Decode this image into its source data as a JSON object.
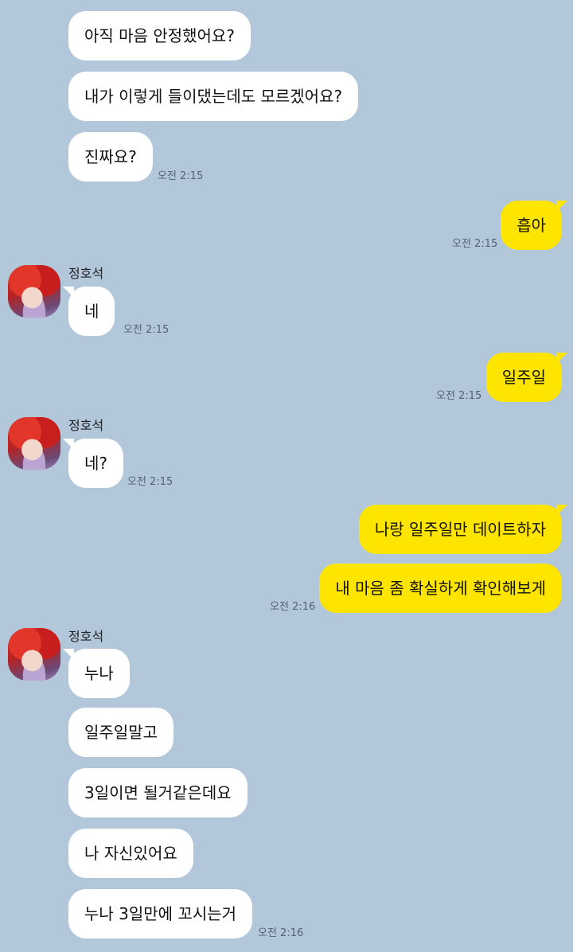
{
  "chat": {
    "sender_name": "정호석",
    "msg1": "아직 마음 안정했어요?",
    "msg2": "내가 이렇게 들이댔는데도 모르겠어요?",
    "msg3": "진짜요?",
    "time1": "오전 2:15",
    "msg4": "흡아",
    "time2": "오전 2:15",
    "msg5": "네",
    "time3": "오전 2:15",
    "msg6": "일주일",
    "time4": "오전 2:15",
    "msg7": "네?",
    "time5": "오전 2:15",
    "msg8": "나랑 일주일만 데이트하자",
    "msg9": "내 마음 좀 확실하게 확인해보게",
    "time6": "오전 2:16",
    "msg10": "누나",
    "msg11": "일주일말고",
    "msg12": "3일이면 될거같은데요",
    "msg13": "나 자신있어요",
    "msg14": "누나 3일만에 꼬시는거",
    "time7": "오전 2:16"
  },
  "colors": {
    "background": "#b2c7da",
    "incoming_bubble": "#ffffff",
    "outgoing_bubble": "#fee500"
  },
  "icons": {
    "avatar": "profile-photo"
  }
}
